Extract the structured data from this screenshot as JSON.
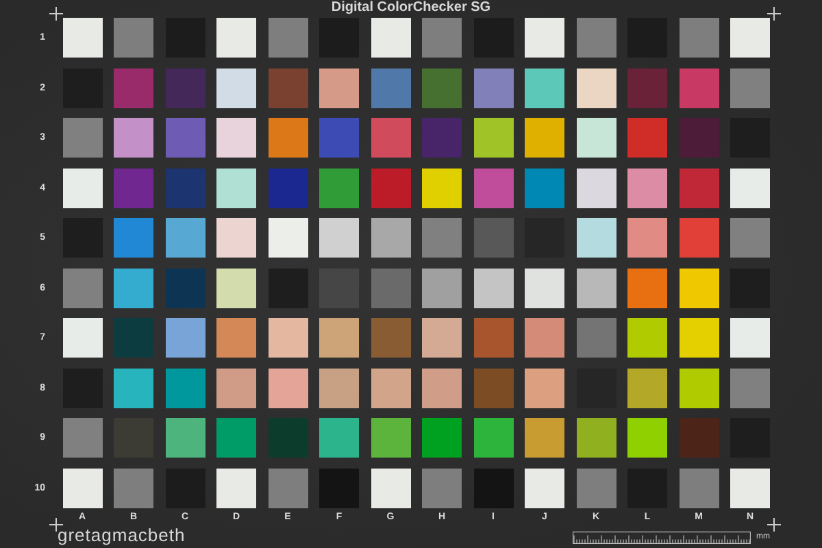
{
  "title": "Digital ColorChecker SG",
  "columns": [
    "A",
    "B",
    "C",
    "D",
    "E",
    "F",
    "G",
    "H",
    "I",
    "J",
    "K",
    "L",
    "M",
    "N"
  ],
  "rows": [
    {
      "label": "1",
      "patches": [
        {
          "color": "#e8eae6"
        },
        {
          "color": "#7e7e7e"
        },
        {
          "color": "#1c1c1c"
        },
        {
          "color": "#e8eae6"
        },
        {
          "color": "#7e7e7e"
        },
        {
          "color": "#1c1c1c"
        },
        {
          "color": "#e8eae6"
        },
        {
          "color": "#7e7e7e"
        },
        {
          "color": "#1c1c1c"
        },
        {
          "color": "#e8eae6"
        },
        {
          "color": "#7e7e7e"
        },
        {
          "color": "#1c1c1c"
        },
        {
          "color": "#7e7e7e"
        },
        {
          "color": "#e8eae6"
        }
      ]
    },
    {
      "label": "2",
      "patches": [
        {
          "color": "#1e1e1e"
        },
        {
          "color": "#9a2b6a"
        },
        {
          "color": "#45285a"
        },
        {
          "color": "#d2dce6"
        },
        {
          "color": "#7a4030"
        },
        {
          "color": "#d69a88"
        },
        {
          "color": "#5078a8"
        },
        {
          "color": "#457030"
        },
        {
          "color": "#8280b8"
        },
        {
          "color": "#5cc8b8"
        },
        {
          "color": "#ead6c2"
        },
        {
          "color": "#6a2238"
        },
        {
          "color": "#c83a64"
        },
        {
          "color": "#808080"
        }
      ]
    },
    {
      "label": "3",
      "patches": [
        {
          "color": "#808080"
        },
        {
          "color": "#c490c8"
        },
        {
          "color": "#6e5cb4"
        },
        {
          "color": "#e8d2dc"
        },
        {
          "color": "#dc7818"
        },
        {
          "color": "#3c4cb4"
        },
        {
          "color": "#d04c5c"
        },
        {
          "color": "#482468"
        },
        {
          "color": "#a0c428"
        },
        {
          "color": "#e0b000"
        },
        {
          "color": "#c8e6d8"
        },
        {
          "color": "#d02c28"
        },
        {
          "color": "#4c1c38"
        },
        {
          "color": "#1e1e1e"
        }
      ]
    },
    {
      "label": "4",
      "patches": [
        {
          "color": "#e8ece8"
        },
        {
          "color": "#702890"
        },
        {
          "color": "#1c3470"
        },
        {
          "color": "#b0e0d4"
        },
        {
          "color": "#1a2890"
        },
        {
          "color": "#309c38"
        },
        {
          "color": "#bc1c28"
        },
        {
          "color": "#e0d000"
        },
        {
          "color": "#c04c9c"
        },
        {
          "color": "#0088b4"
        },
        {
          "color": "#dcd8e0"
        },
        {
          "color": "#dc8ca4"
        },
        {
          "color": "#c02838"
        },
        {
          "color": "#e8ece8"
        }
      ]
    },
    {
      "label": "5",
      "patches": [
        {
          "color": "#1e1e1e"
        },
        {
          "color": "#2088d4"
        },
        {
          "color": "#58a8d4"
        },
        {
          "color": "#ecd4d0"
        },
        {
          "color": "#eceeea"
        },
        {
          "color": "#d0d0d0"
        },
        {
          "color": "#a8a8a8"
        },
        {
          "color": "#808080"
        },
        {
          "color": "#585858"
        },
        {
          "color": "#262626"
        },
        {
          "color": "#b4dce0"
        },
        {
          "color": "#e08c84"
        },
        {
          "color": "#e04038"
        },
        {
          "color": "#808080"
        }
      ]
    },
    {
      "label": "6",
      "patches": [
        {
          "color": "#808080"
        },
        {
          "color": "#34acd0"
        },
        {
          "color": "#0e3454"
        },
        {
          "color": "#d2dcac"
        },
        {
          "color": "#1e1e1e"
        },
        {
          "color": "#464646"
        },
        {
          "color": "#6a6a6a"
        },
        {
          "color": "#a0a0a0"
        },
        {
          "color": "#c4c4c4"
        },
        {
          "color": "#e0e2e0"
        },
        {
          "color": "#b8b8b8"
        },
        {
          "color": "#e87010"
        },
        {
          "color": "#f0c800"
        },
        {
          "color": "#1e1e1e"
        }
      ]
    },
    {
      "label": "7",
      "patches": [
        {
          "color": "#e8ece8"
        },
        {
          "color": "#0c3c40"
        },
        {
          "color": "#78a4d8"
        },
        {
          "color": "#d48858"
        },
        {
          "color": "#e4b8a0"
        },
        {
          "color": "#cca478"
        },
        {
          "color": "#8a5c34"
        },
        {
          "color": "#d4aa94"
        },
        {
          "color": "#a8542c"
        },
        {
          "color": "#d48c78"
        },
        {
          "color": "#747474"
        },
        {
          "color": "#b0cc00"
        },
        {
          "color": "#e4d000"
        },
        {
          "color": "#e8ece8"
        }
      ]
    },
    {
      "label": "8",
      "patches": [
        {
          "color": "#1e1e1e"
        },
        {
          "color": "#28b4bc"
        },
        {
          "color": "#00989c"
        },
        {
          "color": "#d09c88"
        },
        {
          "color": "#e4a498"
        },
        {
          "color": "#c8a084"
        },
        {
          "color": "#d2a48a"
        },
        {
          "color": "#d09e88"
        },
        {
          "color": "#7c4c24"
        },
        {
          "color": "#dca080"
        },
        {
          "color": "#262626"
        },
        {
          "color": "#b4a828"
        },
        {
          "color": "#b0cc00"
        },
        {
          "color": "#808080"
        }
      ]
    },
    {
      "label": "9",
      "patches": [
        {
          "color": "#808080"
        },
        {
          "color": "#3c3c34"
        },
        {
          "color": "#4cb47c"
        },
        {
          "color": "#009c68"
        },
        {
          "color": "#0c3c2c"
        },
        {
          "color": "#2cb48c"
        },
        {
          "color": "#5cb43c"
        },
        {
          "color": "#00a020"
        },
        {
          "color": "#2cb43c"
        },
        {
          "color": "#c89c30"
        },
        {
          "color": "#90b020"
        },
        {
          "color": "#90d000"
        },
        {
          "color": "#4c2418"
        },
        {
          "color": "#1e1e1e"
        }
      ]
    },
    {
      "label": "10",
      "patches": [
        {
          "color": "#e8eae6"
        },
        {
          "color": "#7e7e7e"
        },
        {
          "color": "#1c1c1c"
        },
        {
          "color": "#e8eae6"
        },
        {
          "color": "#7e7e7e"
        },
        {
          "color": "#141414"
        },
        {
          "color": "#e8eae6"
        },
        {
          "color": "#7e7e7e"
        },
        {
          "color": "#141414"
        },
        {
          "color": "#e8eae6"
        },
        {
          "color": "#7e7e7e"
        },
        {
          "color": "#1c1c1c"
        },
        {
          "color": "#7e7e7e"
        },
        {
          "color": "#e8eae6"
        }
      ]
    }
  ],
  "brand": "gretagmacbeth",
  "ruler_unit": "mm"
}
